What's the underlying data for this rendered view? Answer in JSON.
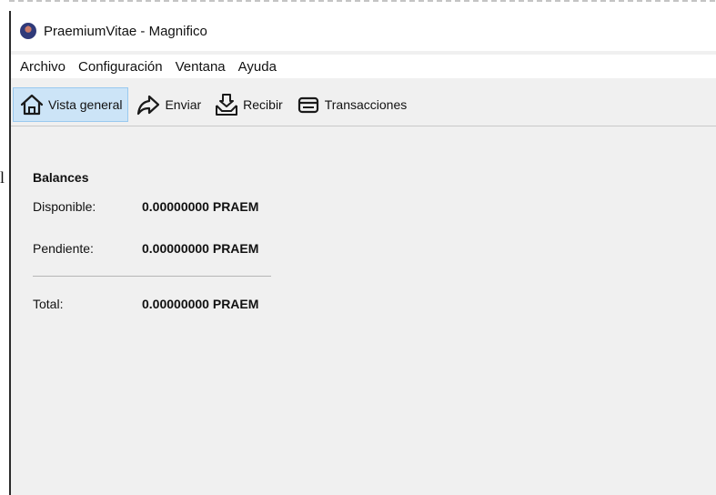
{
  "window": {
    "title": "PraemiumVitae - Magnifico",
    "app_icon": "app-logo-icon"
  },
  "menubar": {
    "items": [
      {
        "label": "Archivo"
      },
      {
        "label": "Configuración"
      },
      {
        "label": "Ventana"
      },
      {
        "label": "Ayuda"
      }
    ]
  },
  "toolbar": {
    "items": [
      {
        "label": "Vista general",
        "icon": "home-icon",
        "active": true
      },
      {
        "label": "Enviar",
        "icon": "send-arrow-icon",
        "active": false
      },
      {
        "label": "Recibir",
        "icon": "receive-inbox-icon",
        "active": false
      },
      {
        "label": "Transacciones",
        "icon": "transactions-card-icon",
        "active": false
      }
    ]
  },
  "overview": {
    "stray_mark": "l",
    "balances_title": "Balances",
    "available_label": "Disponible:",
    "available_value": "0.00000000 PRAEM",
    "pending_label": "Pendiente:",
    "pending_value": "0.00000000 PRAEM",
    "total_label": "Total:",
    "total_value": "0.00000000 PRAEM"
  },
  "colors": {
    "active_tab_bg": "#cce4f7",
    "active_tab_border": "#99c9ef",
    "window_bg": "#f0f0f0"
  }
}
